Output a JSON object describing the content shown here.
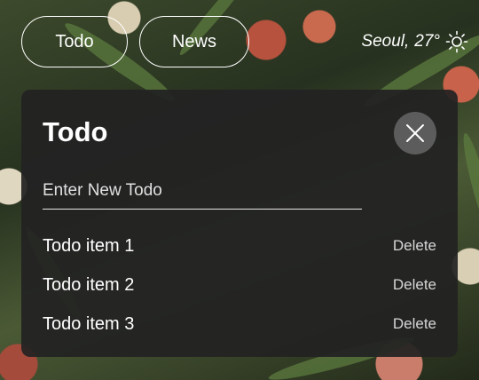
{
  "nav": {
    "tabs": [
      {
        "label": "Todo"
      },
      {
        "label": "News"
      }
    ]
  },
  "weather": {
    "city": "Seoul,",
    "temperature": "27°",
    "icon": "sun-icon"
  },
  "todo_card": {
    "title": "Todo",
    "input_placeholder": "Enter New Todo",
    "input_value": "",
    "close_icon": "close-icon",
    "items": [
      {
        "label": "Todo item 1",
        "action": "Delete"
      },
      {
        "label": "Todo item 2",
        "action": "Delete"
      },
      {
        "label": "Todo item 3",
        "action": "Delete"
      }
    ]
  },
  "colors": {
    "card_bg": "#222222",
    "close_button_bg": "#5c5c5c",
    "text": "#ffffff"
  }
}
